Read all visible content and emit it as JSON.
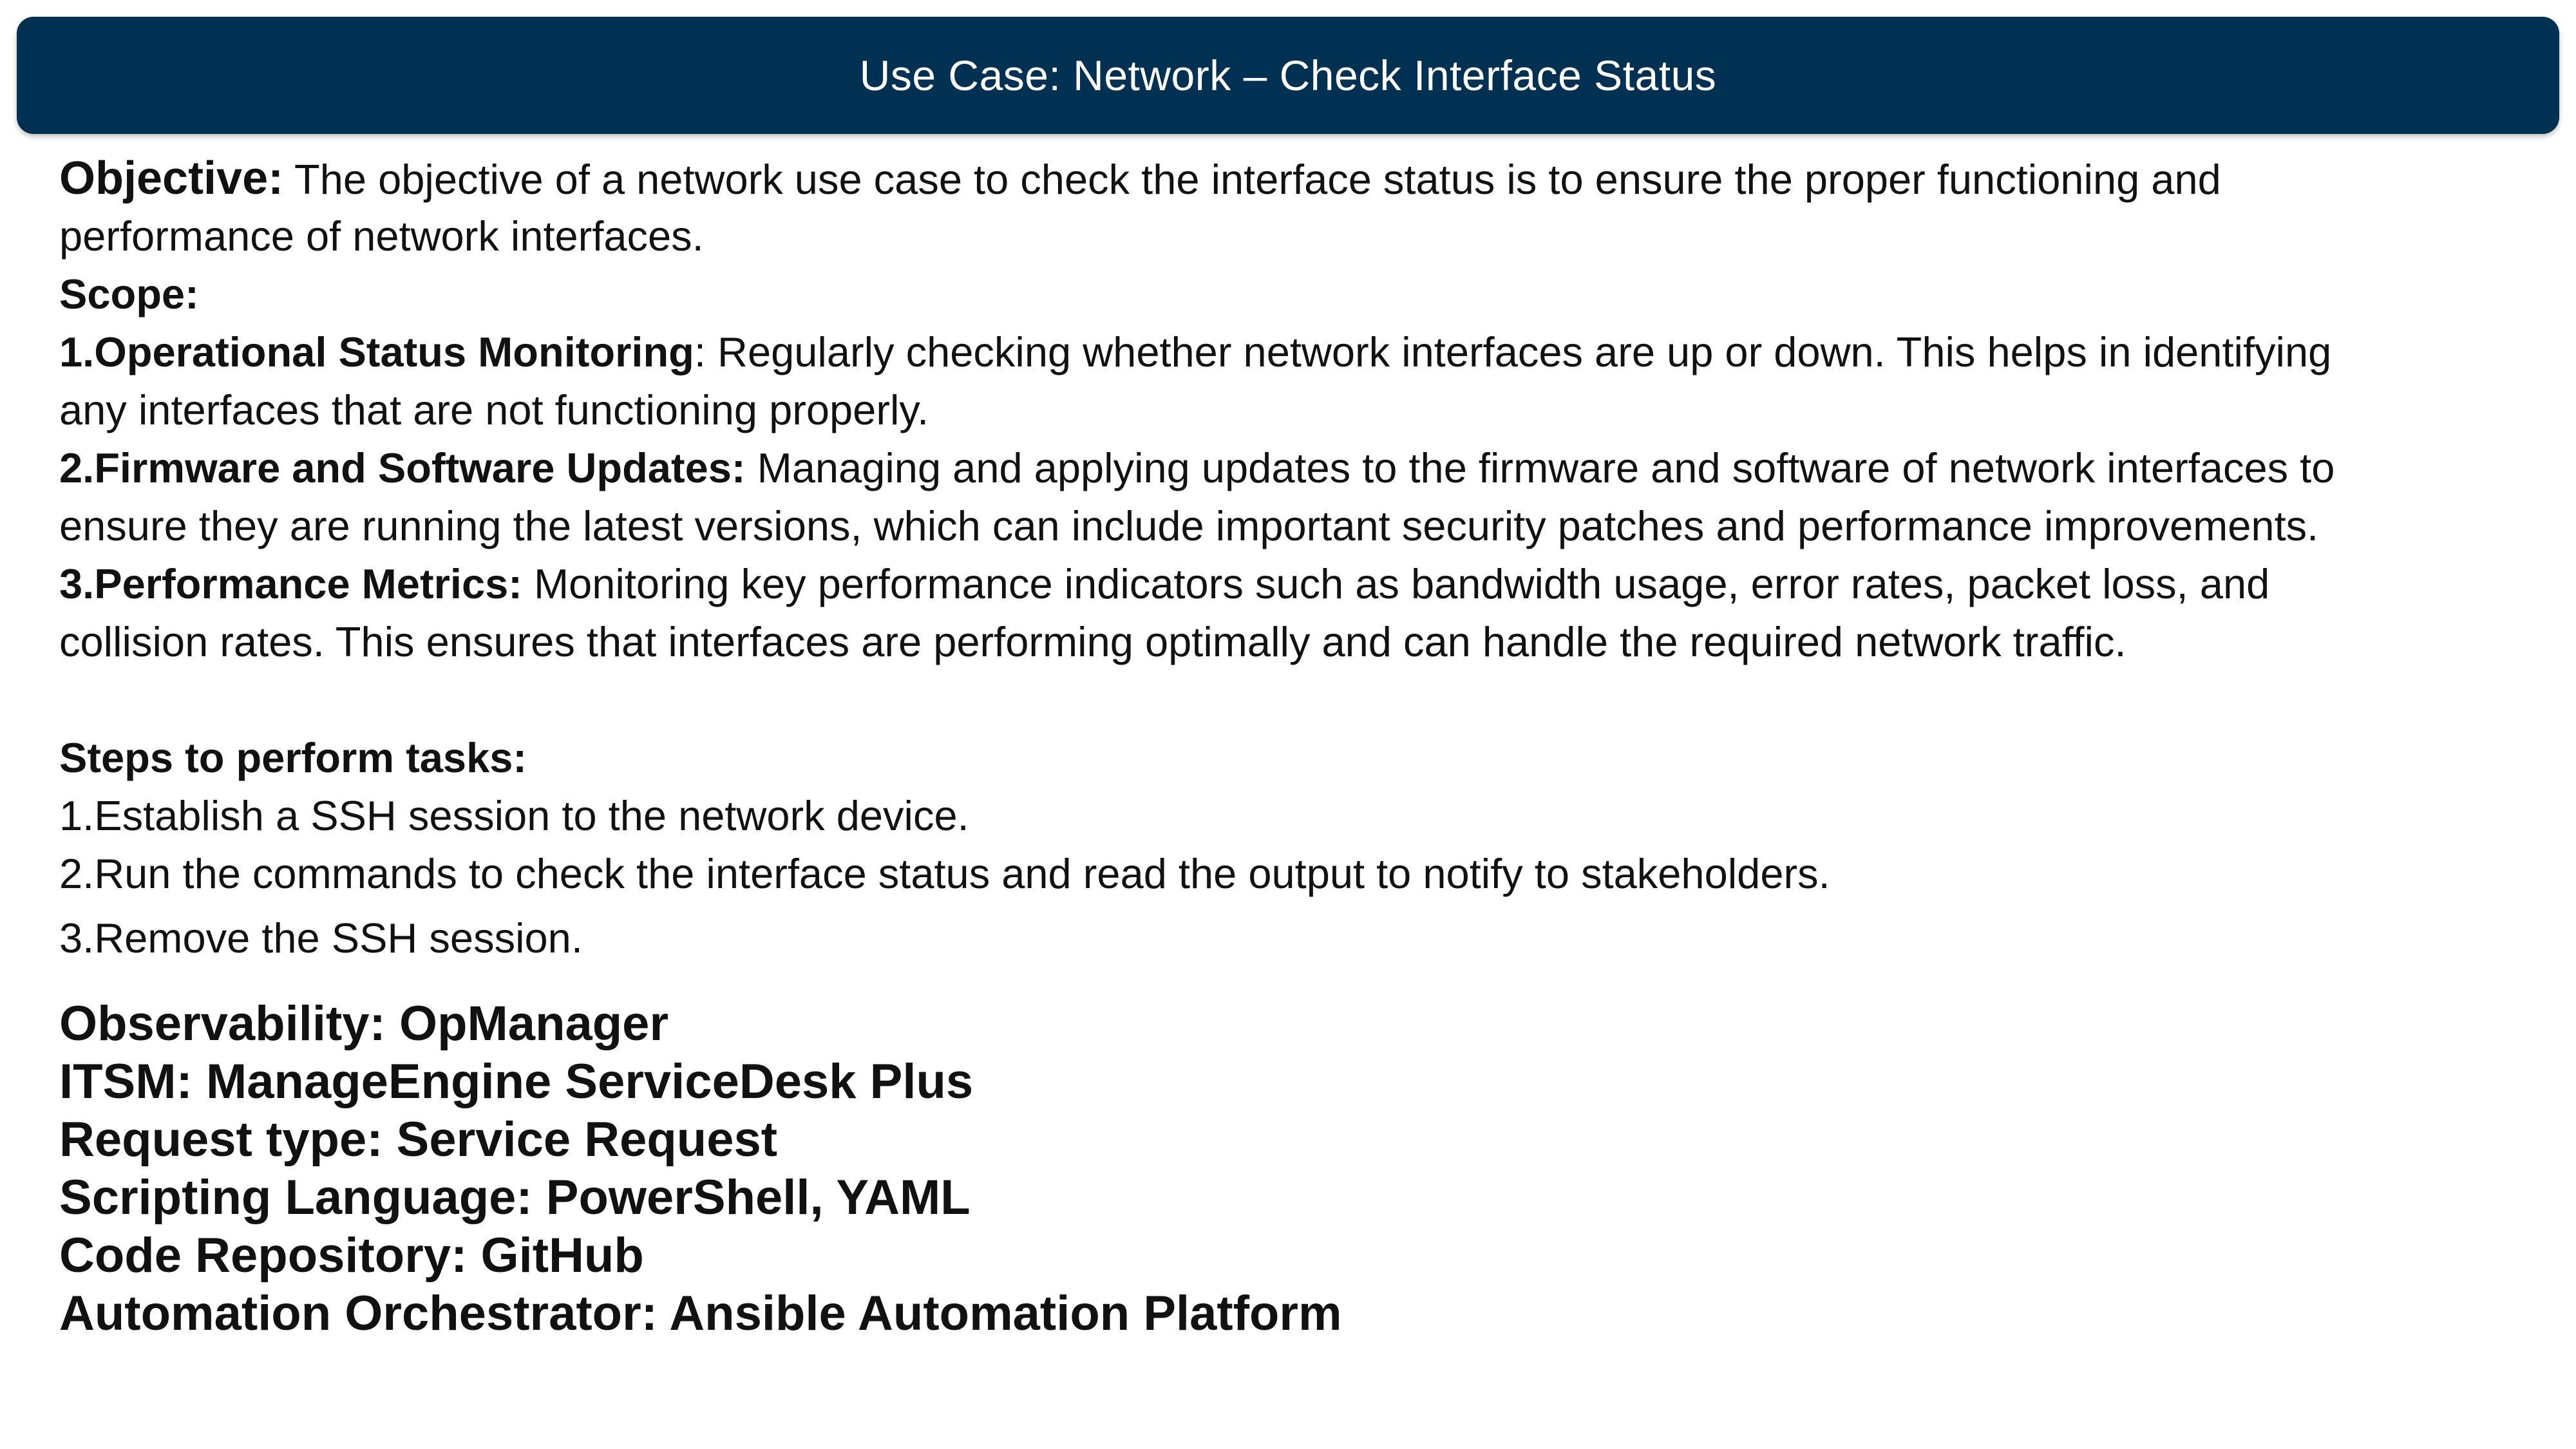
{
  "header": {
    "title": "Use Case: Network – Check Interface Status"
  },
  "objective": {
    "label": "Objective:",
    "text_line1": " The objective of a network use case to check the interface status is to ensure the proper functioning and",
    "text_line2": "performance of network interfaces."
  },
  "scope": {
    "label": "Scope:",
    "items": [
      {
        "title": "1.Operational Status Monitoring",
        "text_line1": ": Regularly checking whether network interfaces are up or down. This helps in identifying",
        "text_line2": "any interfaces that are not functioning properly."
      },
      {
        "title": "2.Firmware and Software Updates:",
        "text_line1": " Managing and applying updates to the firmware and software of network interfaces to",
        "text_line2": "ensure they are running the latest versions, which can include important security patches and performance improvements."
      },
      {
        "title": "3.Performance Metrics:",
        "text_line1": " Monitoring key performance indicators such as bandwidth usage, error rates, packet loss, and",
        "text_line2": "collision rates. This ensures that interfaces are performing optimally and can handle the required network traffic."
      }
    ]
  },
  "steps": {
    "label": "Steps to perform tasks:",
    "items": [
      "1.Establish a SSH session to the network device.",
      "2.Run the commands to check the interface status and read the output to notify to stakeholders.",
      "3.Remove the SSH session."
    ]
  },
  "meta": {
    "observability": "Observability: OpManager",
    "itsm": "ITSM: ManageEngine ServiceDesk Plus",
    "request_type": "Request type: Service Request",
    "scripting": "Scripting Language: PowerShell, YAML",
    "repository": "Code Repository: GitHub",
    "orchestrator": "Automation Orchestrator: Ansible Automation Platform"
  },
  "colors": {
    "header_bg": "#003152",
    "header_text": "#ffffff",
    "body_text": "#111111"
  }
}
